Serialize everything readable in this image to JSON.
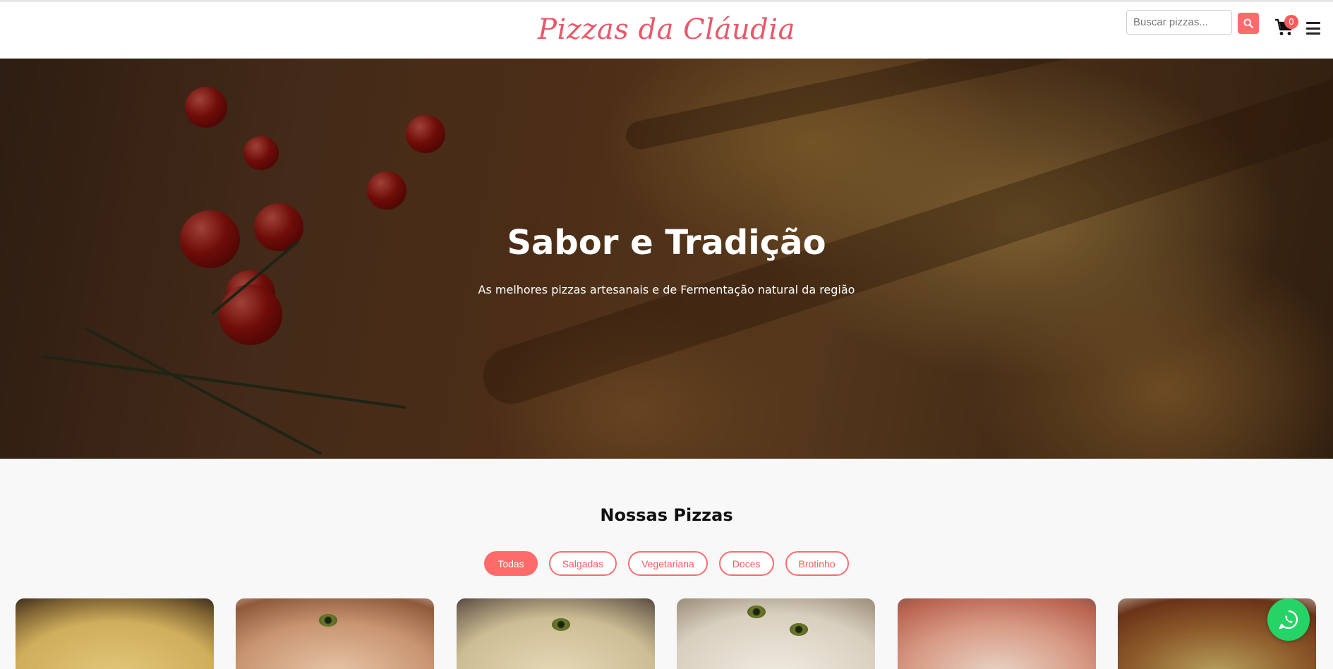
{
  "header": {
    "logo": "Pizzas da Cláudia",
    "search_placeholder": "Buscar pizzas...",
    "search_icon": "search-icon",
    "cart_icon": "cart-icon",
    "cart_count": "0",
    "menu_icon": "hamburger-menu-icon"
  },
  "hero": {
    "title": "Sabor e Tradição",
    "subtitle": "As melhores pizzas artesanais e de Fermentação natural da região"
  },
  "menu_section": {
    "title": "Nossas Pizzas",
    "filters": [
      "Todas",
      "Salgadas",
      "Vegetariana",
      "Doces",
      "Brotinho"
    ],
    "active_filter": "Todas"
  },
  "floating": {
    "whatsapp_icon": "whatsapp-icon"
  },
  "colors": {
    "accent": "#ff6b6b",
    "logo": "#e8596a",
    "whatsapp": "#25d366"
  }
}
